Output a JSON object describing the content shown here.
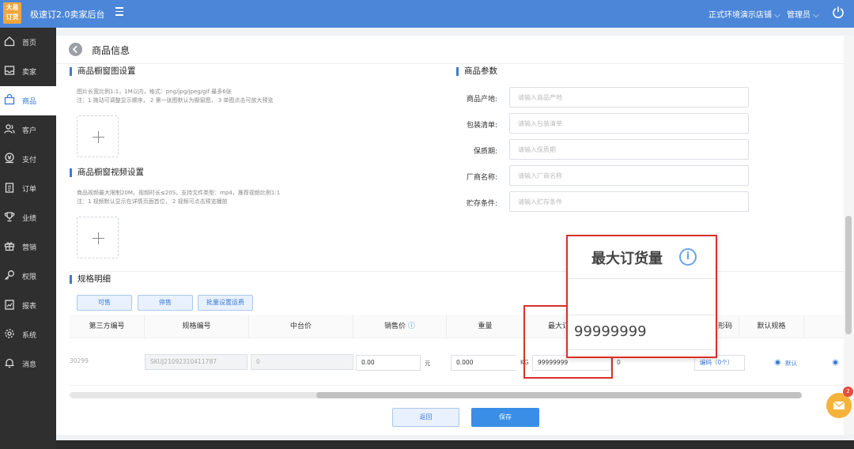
{
  "app": {
    "logo_text": "大易\n订货",
    "title": "极速订2.0卖家后台",
    "store": "正式环境演示店铺",
    "user": "管理员"
  },
  "sidebar": {
    "items": [
      {
        "label": "首页",
        "icon": "home-icon"
      },
      {
        "label": "卖家",
        "icon": "inbox-icon"
      },
      {
        "label": "商品",
        "icon": "bag-icon",
        "active": true
      },
      {
        "label": "客户",
        "icon": "users-icon"
      },
      {
        "label": "支付",
        "icon": "payment-icon"
      },
      {
        "label": "订单",
        "icon": "clipboard-icon"
      },
      {
        "label": "业绩",
        "icon": "trophy-icon"
      },
      {
        "label": "营销",
        "icon": "gift-icon"
      },
      {
        "label": "权限",
        "icon": "key-icon"
      },
      {
        "label": "报表",
        "icon": "report-icon"
      },
      {
        "label": "系统",
        "icon": "gear-icon"
      },
      {
        "label": "消息",
        "icon": "bell-icon"
      }
    ]
  },
  "page": {
    "title": "商品信息"
  },
  "image_section": {
    "title": "商品橱窗图设置",
    "hint1": "图片长宽比例1:1，1M以内，格式：png/jpg/jpeg/gif 最多6张",
    "hint2": "注：1 拖动可调整显示顺序， 2 第一张图默认为橱窗图， 3 单图点击可放大预览"
  },
  "video_section": {
    "title": "商品橱窗视频设置",
    "hint1": "商品视频最大限制20M，视频时长≤20S，支持文件类型：mp4，推荐视频比例1:1",
    "hint2": "注：1 视频默认显示在详情页面首位， 2 视频可点击预览播放"
  },
  "params": {
    "title": "商品参数",
    "fields": [
      {
        "label": "商品产地:",
        "placeholder": "请输入商品产地"
      },
      {
        "label": "包装清单:",
        "placeholder": "请输入包装清单"
      },
      {
        "label": "保质期:",
        "placeholder": "请输入保质期"
      },
      {
        "label": "厂商名称:",
        "placeholder": "请输入厂商名称"
      },
      {
        "label": "贮存条件:",
        "placeholder": "请输入贮存条件"
      }
    ]
  },
  "spec": {
    "title": "规格明细",
    "buttons": [
      "可售",
      "停售",
      "批量设置运费"
    ],
    "headers": [
      "第三方编号",
      "规格编号",
      "中台价",
      "销售价",
      "重量",
      "最大订",
      "",
      "形码",
      "默认规格"
    ],
    "row": {
      "third_party": "30299",
      "spec_no": "SKUJ21092310411787",
      "mid_price": "0",
      "sale_price": "0.00",
      "sale_unit": "元",
      "weight": "0.000",
      "weight_unit": "KG",
      "max_order": "99999999",
      "extra": "0",
      "barcode_link": "编码（0个）",
      "default_label": "默认"
    }
  },
  "footer": {
    "back": "返回",
    "save": "保存"
  },
  "zoom": {
    "title": "最大订货量",
    "value": "99999999"
  },
  "chat": {
    "badge": "2"
  }
}
